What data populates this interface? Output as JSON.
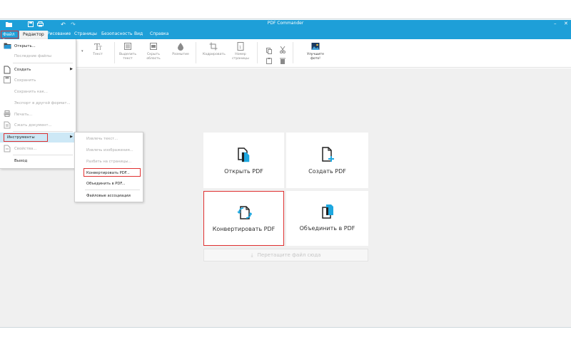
{
  "app": {
    "title": "PDF Commander"
  },
  "menubar": {
    "file": "Файл",
    "items": [
      "Редактор",
      "Рисование",
      "Страницы",
      "Безопасность",
      "Вид",
      "Справка"
    ]
  },
  "ribbon": {
    "items": [
      {
        "label": "Текст"
      },
      {
        "label": "Выделить текст"
      },
      {
        "label": "Скрыть область"
      },
      {
        "label": "Размытие"
      },
      {
        "label": "Кадрировать"
      },
      {
        "label": "Номер страницы"
      },
      {
        "label": "Улучшите фото!"
      }
    ]
  },
  "file_menu": {
    "items": [
      {
        "label": "Открыть...",
        "disabled": false
      },
      {
        "label": "Последние файлы",
        "disabled": true
      },
      {
        "label": "Создать",
        "disabled": false,
        "submenu": true
      },
      {
        "label": "Сохранить",
        "disabled": true
      },
      {
        "label": "Сохранить как...",
        "disabled": true
      },
      {
        "label": "Экспорт в другой формат...",
        "disabled": true
      },
      {
        "label": "Печать...",
        "disabled": true
      },
      {
        "label": "Сжать документ...",
        "disabled": true
      },
      {
        "label": "Инструменты",
        "disabled": false,
        "submenu": true,
        "selected": true
      },
      {
        "label": "Свойства...",
        "disabled": true
      },
      {
        "label": "Выход",
        "disabled": false
      }
    ]
  },
  "tools_submenu": {
    "items": [
      {
        "label": "Извлечь текст...",
        "disabled": true
      },
      {
        "label": "Извлечь изображения...",
        "disabled": true
      },
      {
        "label": "Разбить на страницы...",
        "disabled": true
      },
      {
        "label": "Конвертировать PDF...",
        "disabled": false,
        "highlighted": true
      },
      {
        "label": "Объединить в PDF...",
        "disabled": false
      },
      {
        "label": "Файловые ассоциации",
        "disabled": false
      }
    ]
  },
  "start": {
    "cards": [
      {
        "label": "Открыть PDF"
      },
      {
        "label": "Создать PDF"
      },
      {
        "label": "Конвертировать PDF"
      },
      {
        "label": "Объединить в PDF"
      }
    ],
    "drop_hint": "Перетащите файл сюда"
  },
  "colors": {
    "accent": "#1e9fd8",
    "highlight": "#e03030",
    "icon_blue": "#1ea8e0"
  }
}
